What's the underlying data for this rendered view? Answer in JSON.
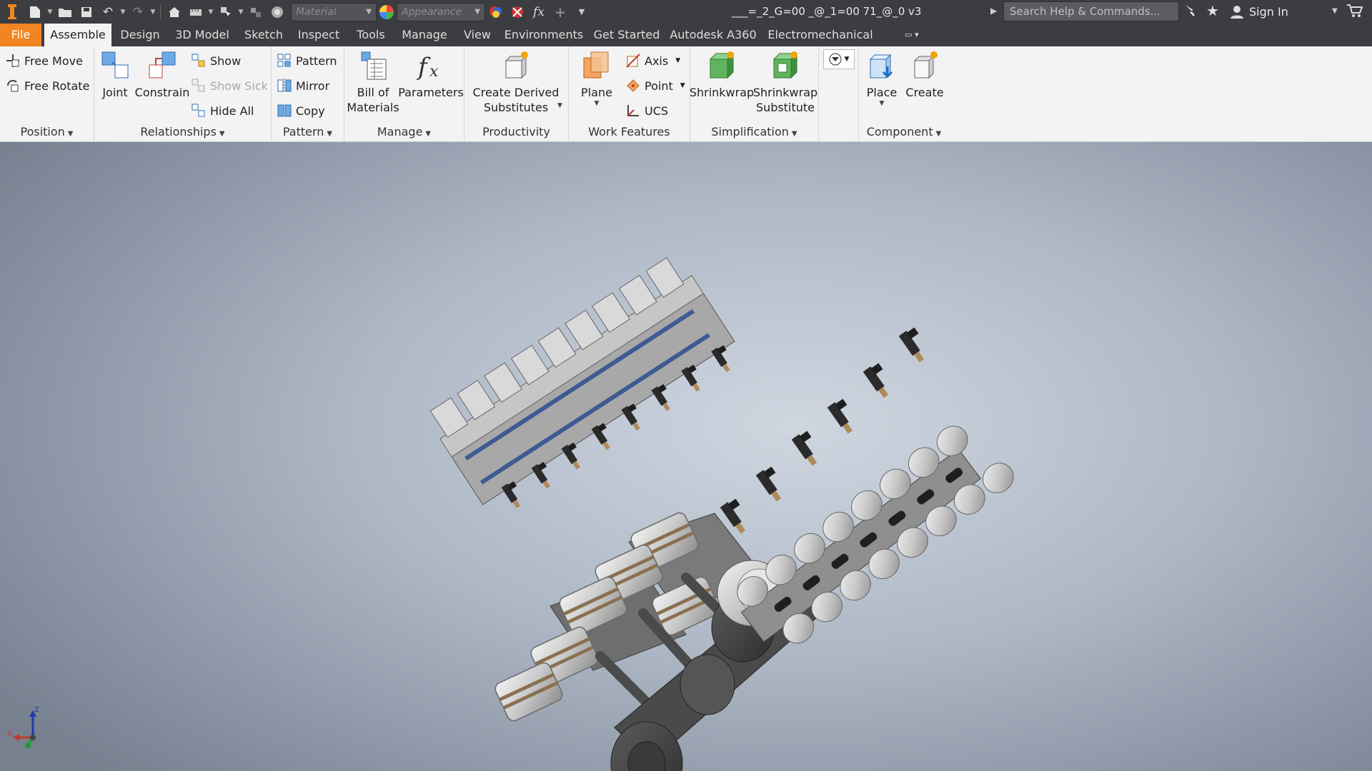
{
  "qat": {
    "material_placeholder": "Material",
    "appearance_placeholder": "Appearance",
    "fx_label": "fx"
  },
  "document_title": "___=_2_G=00 _@_1=00 71_@_0 v3",
  "search": {
    "placeholder": "Search Help & Commands..."
  },
  "user": {
    "sign_in": "Sign In"
  },
  "tabs": [
    {
      "label": "File"
    },
    {
      "label": "Assemble"
    },
    {
      "label": "Design"
    },
    {
      "label": "3D Model"
    },
    {
      "label": "Sketch"
    },
    {
      "label": "Inspect"
    },
    {
      "label": "Tools"
    },
    {
      "label": "Manage"
    },
    {
      "label": "View"
    },
    {
      "label": "Environments"
    },
    {
      "label": "Get Started"
    },
    {
      "label": "Autodesk A360"
    },
    {
      "label": "Electromechanical"
    }
  ],
  "ribbon": {
    "position": {
      "label": "Position",
      "free_move": "Free Move",
      "free_rotate": "Free Rotate"
    },
    "relationships": {
      "label": "Relationships",
      "joint": "Joint",
      "constrain": "Constrain",
      "show": "Show",
      "show_sick": "Show Sick",
      "hide_all": "Hide All"
    },
    "pattern": {
      "label": "Pattern",
      "pattern": "Pattern",
      "mirror": "Mirror",
      "copy": "Copy"
    },
    "manage": {
      "label": "Manage",
      "bom_line1": "Bill of",
      "bom_line2": "Materials",
      "parameters": "Parameters"
    },
    "productivity": {
      "label": "Productivity",
      "cds_line1": "Create Derived",
      "cds_line2": "Substitutes"
    },
    "work_features": {
      "label": "Work Features",
      "plane": "Plane",
      "axis": "Axis",
      "point": "Point",
      "ucs": "UCS"
    },
    "simplification": {
      "label": "Simplification",
      "shrinkwrap": "Shrinkwrap",
      "sws_line1": "Shrinkwrap",
      "sws_line2": "Substitute"
    },
    "component": {
      "label": "Component",
      "place": "Place",
      "create": "Create"
    }
  },
  "triad": {
    "x": "X",
    "y": "Y",
    "z": "Z"
  },
  "colors": {
    "file_tab": "#f08521",
    "dark_chrome": "#3b3d40",
    "ribbon_bg": "#f3f3f3"
  }
}
